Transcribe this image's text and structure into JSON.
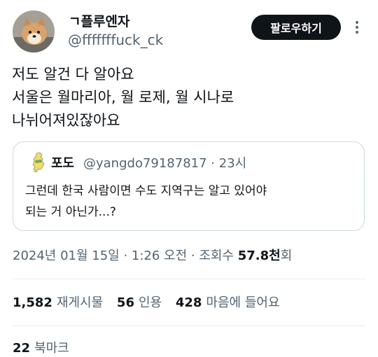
{
  "author": {
    "display_name": "ㄱ플루엔자",
    "handle": "@fffffffuck_ck"
  },
  "follow_button": "팔로우하기",
  "tweet": {
    "lines": [
      "저도 알건 다 알아요",
      "서울은 월마리아, 월 로제, 월 시나로",
      "나뉘어져있잖아요"
    ]
  },
  "quote": {
    "name": "포도",
    "handle_time": "@yangdo79187817 · 23시",
    "lines": [
      "그런데 한국 사람이면 수도 지역구는 알고 있어야",
      "되는 거 아닌가...?"
    ]
  },
  "timestamp": {
    "datetime": "2024년 01월 15일 · 1:26 오전 · 조회수 ",
    "views": "57.8천",
    "views_suffix": "회"
  },
  "stats": {
    "retweets": {
      "count": "1,582",
      "label": "재게시물"
    },
    "quotes": {
      "count": "56",
      "label": "인용"
    },
    "likes": {
      "count": "428",
      "label": "마음에 들어요"
    }
  },
  "bookmarks": {
    "count": "22",
    "label": "북마크"
  },
  "colors": {
    "text": "#0f1419",
    "secondary_text": "#536471",
    "border": "#cfd9de",
    "follow_button_bg": "#0f1419"
  }
}
